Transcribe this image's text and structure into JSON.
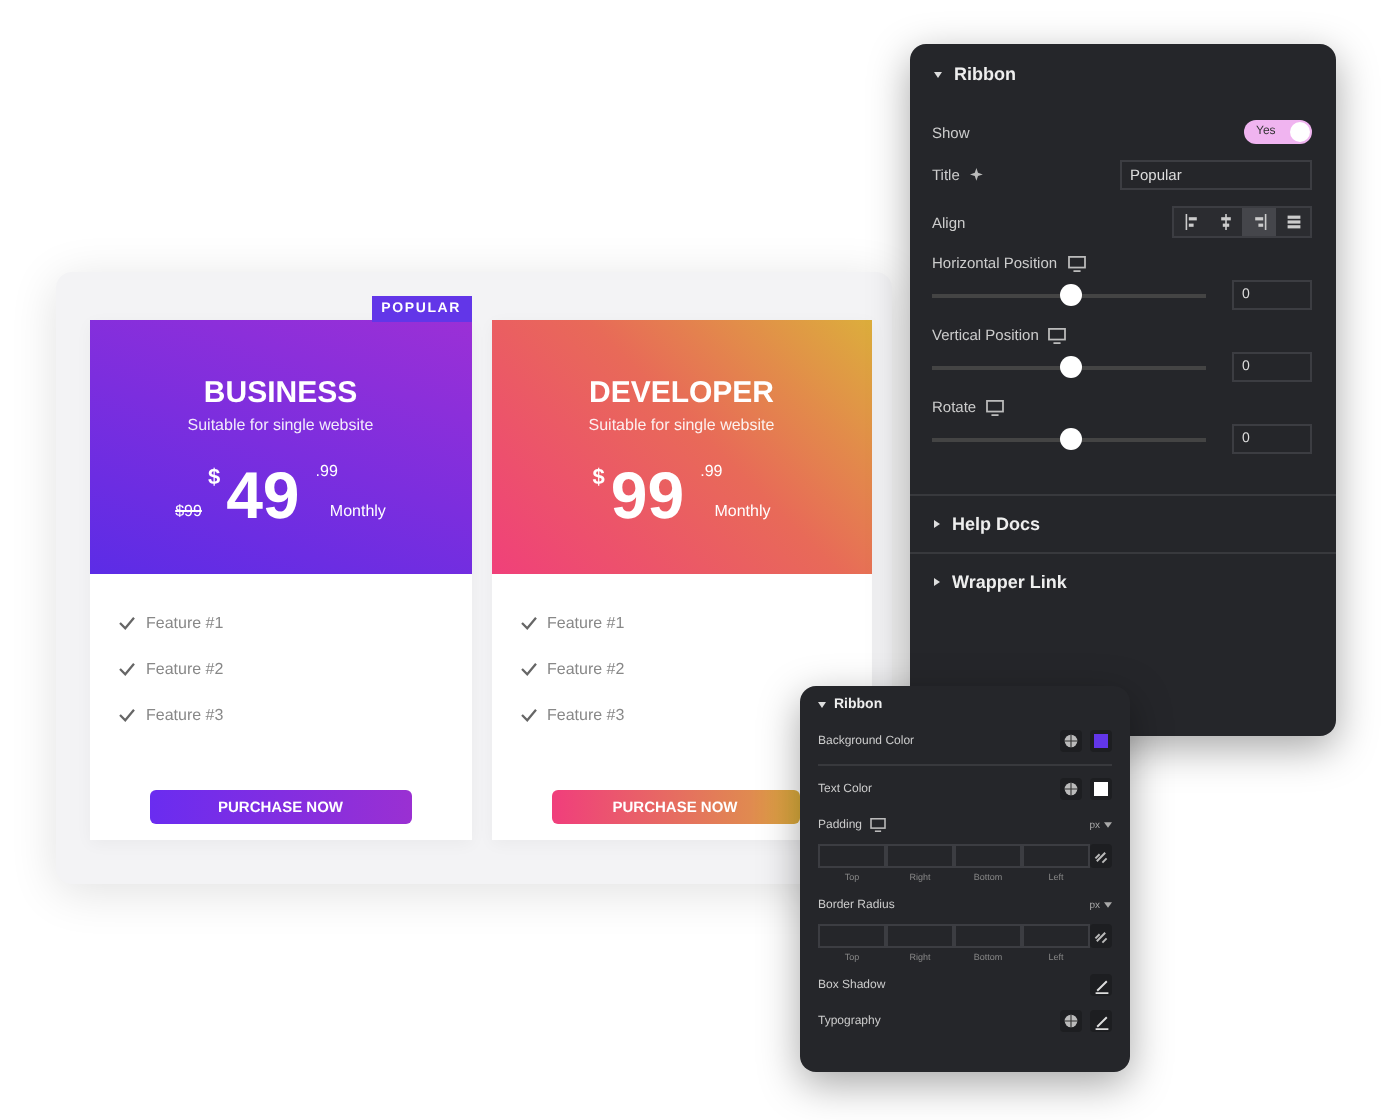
{
  "pricing_cards": [
    {
      "kind": "violet",
      "ribbon": "POPULAR",
      "title": "BUSINESS",
      "subtitle": "Suitable for single website",
      "currency": "$",
      "price": "49",
      "cents": ".99",
      "old_price": "$99",
      "period": "Monthly",
      "features": [
        "Feature #1",
        "Feature #2",
        "Feature #3"
      ],
      "button": "PURCHASE NOW"
    },
    {
      "kind": "sunset",
      "title": "DEVELOPER",
      "subtitle": "Suitable for single website",
      "currency": "$",
      "price": "99",
      "cents": ".99",
      "period": "Monthly",
      "features": [
        "Feature #1",
        "Feature #2",
        "Feature #3"
      ],
      "button": "PURCHASE NOW"
    }
  ],
  "settings_panel": {
    "title": "Ribbon",
    "expanded": true,
    "show": {
      "label": "Show",
      "on": true,
      "text": "Yes"
    },
    "title_field": {
      "label": "Title",
      "value": "Popular"
    },
    "align": {
      "label": "Align",
      "options": [
        {
          "kind": "left",
          "selected": false
        },
        {
          "kind": "center",
          "selected": false
        },
        {
          "kind": "right",
          "selected": true
        },
        {
          "kind": "justify",
          "selected": false
        }
      ]
    },
    "sliders": [
      {
        "label": "Horizontal Position",
        "level": 0.5,
        "value": "0"
      },
      {
        "label": "Vertical Position",
        "level": 0.5,
        "value": "0"
      },
      {
        "label": "Rotate",
        "level": 0.5,
        "value": "0"
      }
    ],
    "sections": [
      {
        "title": "Help Docs",
        "expanded": false
      },
      {
        "title": "Wrapper Link",
        "expanded": false
      }
    ]
  },
  "style_panel": {
    "title": "Ribbon",
    "expanded": true,
    "rows": [
      {
        "kind": "color",
        "label": "Background Color",
        "color": "#6236e8",
        "divider": true
      },
      {
        "kind": "color",
        "label": "Text Color",
        "color": "#ffffff"
      },
      {
        "kind": "dimensions",
        "label": "Padding",
        "unit": "px",
        "responsive": true,
        "sides": [
          "Top",
          "Right",
          "Bottom",
          "Left"
        ]
      },
      {
        "kind": "dimensions",
        "label": "Border Radius",
        "unit": "px",
        "responsive": false,
        "sides": [
          "Top",
          "Right",
          "Bottom",
          "Left"
        ]
      },
      {
        "kind": "popover",
        "label": "Box Shadow",
        "global": false
      },
      {
        "kind": "popover",
        "label": "Typography",
        "global": true
      }
    ]
  }
}
